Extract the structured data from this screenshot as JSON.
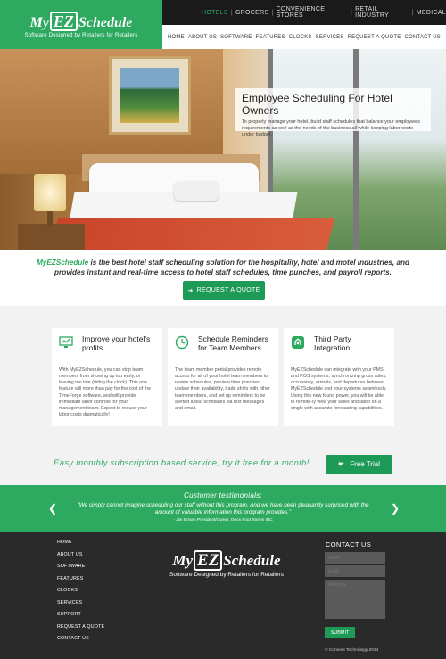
{
  "header": {
    "logo": {
      "brand_pre": "My",
      "brand_ez": "EZ",
      "brand_post": "Schedule",
      "tagline": "Software Designed by Retailers for Retailers"
    },
    "industries": [
      "HOTELS",
      "GROCERS",
      "CONVENIENCE STORES",
      "RETAIL INDUSTRY",
      "MEDICAL"
    ],
    "active_industry": "HOTELS",
    "nav": [
      "HOME",
      "ABOUT US",
      "SOFTWARE",
      "FEATURES",
      "CLOCKS",
      "SERVICES",
      "REQUEST A QUOTE",
      "CONTACT US"
    ]
  },
  "hero": {
    "title": "Employee Scheduling For Hotel Owners",
    "text": "To properly manage your hotel, build staff schedules that balance your employee's requirements as well as the needs of the business all while keeping labor costs under budget."
  },
  "intro": {
    "brand": "MyEZSchedule",
    "text": " is the best hotel staff scheduling solution for the hospitality, hotel and motel industries, and provides instant and real-time access to hotel staff schedules, time punches, and payroll reports.",
    "button": "REQUEST A QUOTE"
  },
  "features": [
    {
      "title": "Improve your hotel's profits",
      "icon": "chart-monitor-icon",
      "body": "With MyEZSchedule, you can stop team members from showing up too early, or leaving too late (riding the clock). This one feature will more than pay for the cost of the TimeForge software, and will provide immediate labor controls for your management team. Expect to reduce your labor costs dramatically!"
    },
    {
      "title": "Schedule Reminders for Team Members",
      "icon": "clock-icon",
      "body": "The team member portal provides remote access for all of your hotel team members to review schedules, preview time punches, update their availability, trade shifts with other team members, and set up reminders to be alerted about schedules via text messages and email."
    },
    {
      "title": "Third Party Integration",
      "icon": "integration-icon",
      "body": "MyEZSchedule can integrate with your PMS and POS systems, synchronizing gross sales, occupancy, arrivals, and departures between MyEZSchedule and your systems seamlessly. Using this new found power, you will be able to remote-ly view your sales and labor on a single with accurate forecasting capabilities."
    }
  ],
  "trial": {
    "text": "Easy monthly subscription based service, try it free for a month!",
    "button": "Free Trial"
  },
  "testimonials": {
    "title": "Customer testimonials:",
    "quote": "\"We simply cannot imagine scheduling our staff without this program. And we have been pleasantly surprised with the amount of valuable information this program provides.\"",
    "author": "- Jim Brown President/Owner, Docs Foot Stores INC"
  },
  "footer": {
    "links": [
      "HOME",
      "ABOUT US",
      "SOFTWARE",
      "FEATURES",
      "CLOCKS",
      "SERVICES",
      "SUPPORT",
      "REQUEST A QUOTE",
      "CONTACT US"
    ],
    "contact_title": "CONTACT US",
    "name_placeholder": "Name",
    "email_placeholder": "Email",
    "message_placeholder": "Message",
    "submit": "SUBMIT",
    "copyright": "© Connect Technology 2014"
  },
  "colors": {
    "accent": "#2eaa60",
    "button": "#1e9a57",
    "dark": "#2a2a2a"
  }
}
